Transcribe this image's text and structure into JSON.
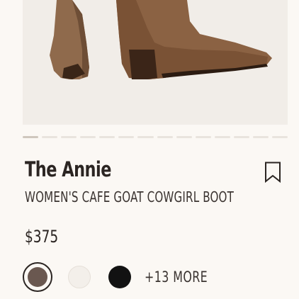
{
  "product": {
    "name": "The Annie",
    "subtitle": "WOMEN'S CAFE GOAT COWGIRL BOOT",
    "price": "$375",
    "more_colors": "+13 MORE"
  },
  "carousel": {
    "count": 14,
    "active_index": 0
  },
  "swatches": [
    {
      "name": "taupe",
      "color": "#6a5850",
      "selected": true
    },
    {
      "name": "bone",
      "color": "#f3efea",
      "selected": false
    },
    {
      "name": "black",
      "color": "#121212",
      "selected": false
    }
  ],
  "icons": {
    "bookmark": "bookmark-icon"
  }
}
